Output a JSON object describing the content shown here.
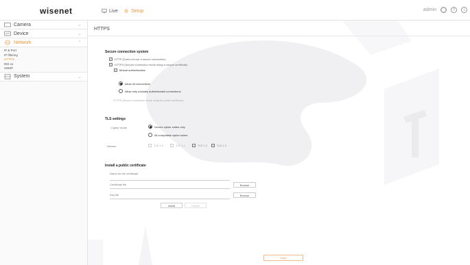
{
  "header": {
    "logo": "wisenet",
    "nav": [
      {
        "label": "Live",
        "icon": "monitor-icon"
      },
      {
        "label": "Setup",
        "icon": "gear-icon"
      }
    ],
    "user": "admin",
    "icons": [
      "user-icon",
      "help-icon",
      "info-icon"
    ]
  },
  "sidebar": {
    "menus": [
      {
        "label": "Camera",
        "icon": "camera-icon"
      },
      {
        "label": "Device",
        "icon": "device-icon"
      },
      {
        "label": "Network",
        "icon": "network-icon",
        "active": true
      },
      {
        "label": "System",
        "icon": "system-icon"
      }
    ],
    "network_items": [
      "IP & Port",
      "IP filtering",
      "HTTPS",
      "802.1x",
      "SNMP"
    ],
    "network_active_item": "HTTPS"
  },
  "page": {
    "title": "HTTPS",
    "secure": {
      "heading": "Secure connection system",
      "opt1": "HTTP (Does not use a secure connection)",
      "opt2": "HTTPS (Secure connection mode using a unique certificate)",
      "mutual": "Mutual authentication",
      "allow_all": "Allow all connections",
      "allow_mutual": "Allow only mutually authenticated connections",
      "note": "HTTPS (Secure connection mode using the public certificate)"
    },
    "tls": {
      "heading": "TLS settings",
      "cipher_label": "Cipher mode",
      "cipher_secure": "Secure cipher suites only",
      "cipher_all": "All compatible cipher suites",
      "version_label": "Version",
      "versions": [
        {
          "label": "TLS 1.0",
          "checked": false
        },
        {
          "label": "TLS 1.1",
          "checked": false
        },
        {
          "label": "TLS 1.2",
          "checked": true
        },
        {
          "label": "TLS 1.3",
          "checked": true
        }
      ]
    },
    "cert": {
      "heading": "Install a public certificate",
      "name_label": "Name for the certificate",
      "cert_label": "Certificate file",
      "key_label": "Key file",
      "browse1": "Browse",
      "browse2": "Browse",
      "install": "Install",
      "delete": "Delete"
    },
    "apply": "Apply"
  },
  "colors": {
    "accent": "#f0953a",
    "border": "#e4e4e4"
  }
}
